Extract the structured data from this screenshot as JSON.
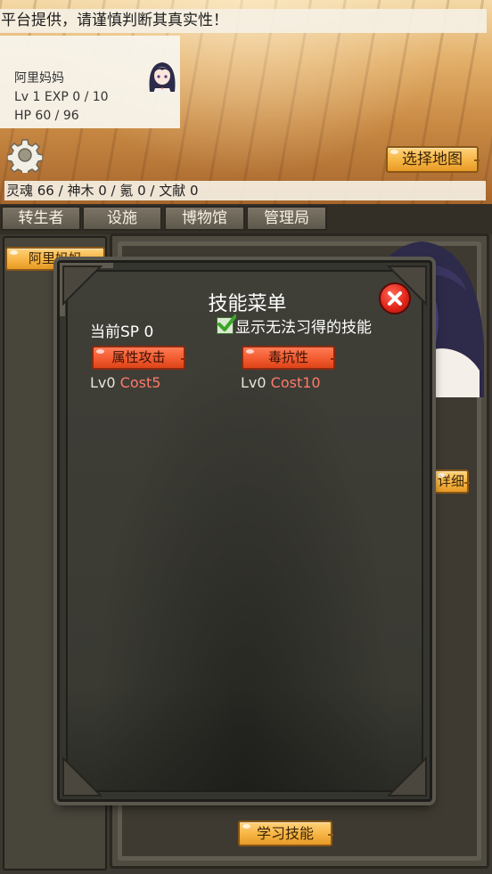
{
  "notice": "平台提供，请谨慎判断其真实性！",
  "character": {
    "name": "阿里妈妈",
    "level_exp": "Lv 1 EXP 0 / 10",
    "hp": "HP 60 / 96"
  },
  "settings_icon": "gear-icon",
  "map_button": "选择地图",
  "resources": "灵魂 66 / 神木 0 / 氪 0 / 文献 0",
  "tabs": [
    "转生者",
    "设施",
    "博物馆",
    "管理局"
  ],
  "list": {
    "items": [
      "阿里妈妈"
    ]
  },
  "detail_button": "详细",
  "learn_button": "学习技能",
  "skill_menu": {
    "title": "技能菜单",
    "current_sp": "当前SP 0",
    "show_unlearnable_label": "显示无法习得的技能",
    "show_unlearnable_checked": true,
    "skills": [
      {
        "name": "属性攻击",
        "level": "Lv0",
        "cost": "Cost5"
      },
      {
        "name": "毒抗性",
        "level": "Lv0",
        "cost": "Cost10"
      }
    ],
    "close_icon": "close-icon"
  },
  "colors": {
    "orange_button": "#f6b443",
    "red_button": "#f25b2f",
    "cost_text": "#ff7a6a",
    "panel_dark": "#3a3a33"
  }
}
